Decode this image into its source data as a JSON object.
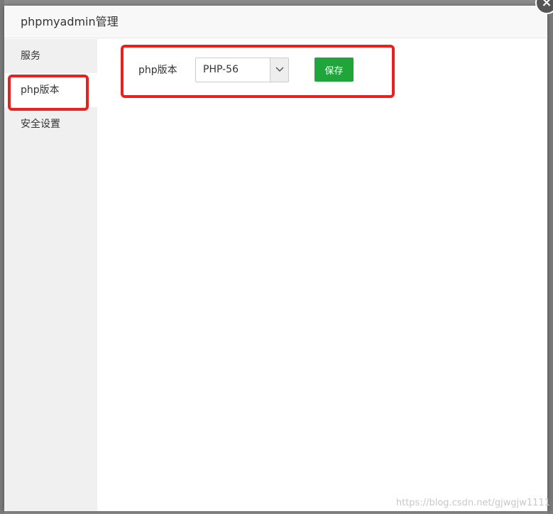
{
  "dialog": {
    "title": "phpmyadmin管理",
    "close_symbol": "×"
  },
  "sidebar": {
    "items": [
      {
        "label": "服务",
        "active": false
      },
      {
        "label": "php版本",
        "active": true
      },
      {
        "label": "安全设置",
        "active": false
      }
    ]
  },
  "form": {
    "label": "php版本",
    "select_value": "PHP-56",
    "save_label": "保存"
  },
  "watermark": "https://blog.csdn.net/gjwgjw1111",
  "colors": {
    "accent_green": "#20a53a",
    "highlight_red": "#e8211f"
  }
}
